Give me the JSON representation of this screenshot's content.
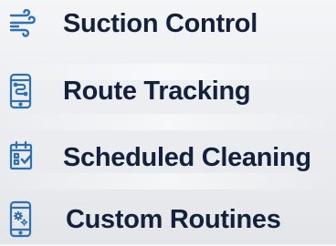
{
  "colors": {
    "icon_blue": "#2f6fb4",
    "label_navy": "#14213d"
  },
  "features": [
    {
      "label": "Suction Control",
      "icon": "wind-icon"
    },
    {
      "label": "Route Tracking",
      "icon": "phone-route-icon"
    },
    {
      "label": "Scheduled Cleaning",
      "icon": "calendar-check-icon"
    },
    {
      "label": "Custom Routines",
      "icon": "phone-gears-icon"
    }
  ]
}
